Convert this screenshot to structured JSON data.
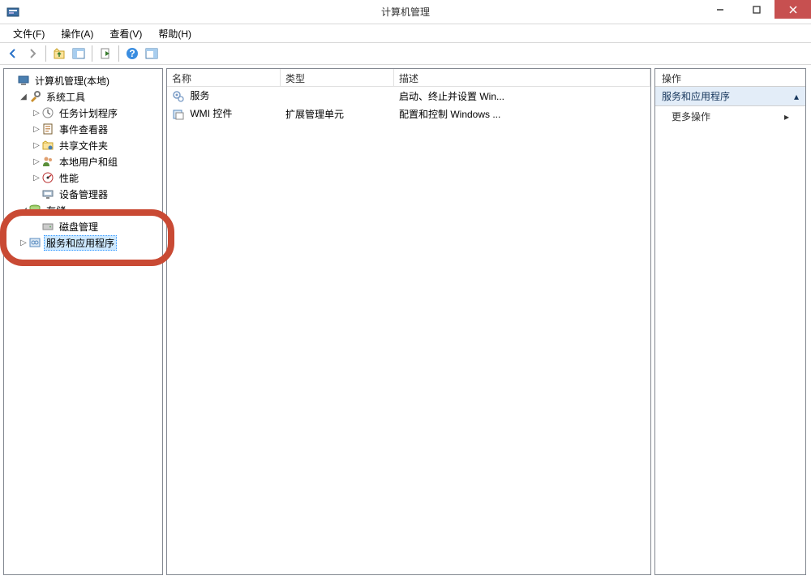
{
  "window": {
    "title": "计算机管理"
  },
  "menu": {
    "file": "文件(F)",
    "action": "操作(A)",
    "view": "查看(V)",
    "help": "帮助(H)"
  },
  "tree": {
    "root": "计算机管理(本地)",
    "system_tools": "系统工具",
    "task_scheduler": "任务计划程序",
    "event_viewer": "事件查看器",
    "shared_folders": "共享文件夹",
    "local_users": "本地用户和组",
    "performance": "性能",
    "device_manager": "设备管理器",
    "storage": "存储",
    "disk_management": "磁盘管理",
    "services_apps": "服务和应用程序"
  },
  "list": {
    "col_name": "名称",
    "col_type": "类型",
    "col_desc": "描述",
    "rows": [
      {
        "name": "服务",
        "type": "",
        "desc": "启动、终止并设置 Win..."
      },
      {
        "name": "WMI 控件",
        "type": "扩展管理单元",
        "desc": "配置和控制 Windows ..."
      }
    ]
  },
  "actions": {
    "header": "操作",
    "group": "服务和应用程序",
    "more": "更多操作"
  }
}
